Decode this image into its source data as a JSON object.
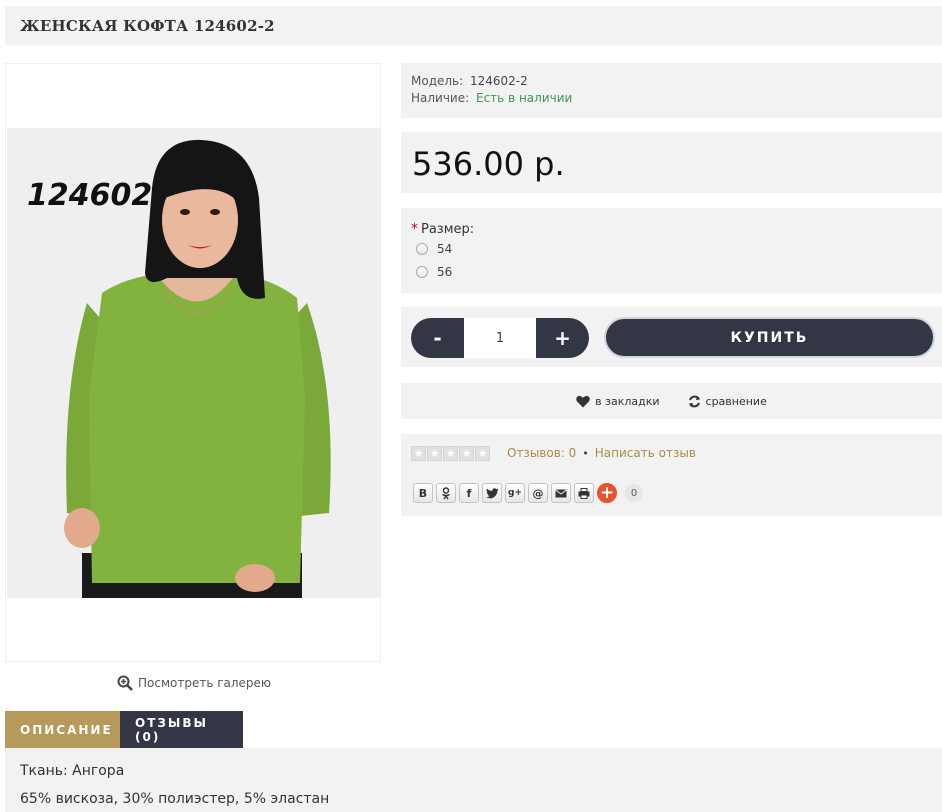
{
  "product": {
    "title": "ЖЕНСКАЯ КОФТА 124602-2",
    "image_code": "124602",
    "gallery_link": "Посмотреть галерею"
  },
  "info": {
    "model_label": "Модель:",
    "model_value": "124602-2",
    "availability_label": "Наличие:",
    "availability_value": "Есть в наличии",
    "availability_color": "#3c9a4a"
  },
  "price": "536.00 р.",
  "options": {
    "label": "Размер:",
    "required_mark": "*",
    "sizes": [
      "54",
      "56"
    ]
  },
  "purchase": {
    "minus": "-",
    "quantity": "1",
    "plus": "+",
    "buy_label": "КУПИТЬ"
  },
  "actions": {
    "bookmark_label": "в закладки",
    "compare_label": "сравнение"
  },
  "rating": {
    "stars": 0,
    "max_stars": 5,
    "reviews_label": "Отзывов: 0",
    "separator": "•",
    "write_review": "Написать отзыв"
  },
  "share": {
    "buttons": [
      "vk-icon",
      "odnoklassniki-icon",
      "facebook-icon",
      "twitter-icon",
      "google-plus-icon",
      "mailru-icon",
      "email-icon",
      "print-icon",
      "more-share-icon"
    ],
    "glyphs": [
      "В",
      "ok",
      "f",
      "tw",
      "g+",
      "@",
      "✉",
      "⎙",
      "+"
    ],
    "count": "0"
  },
  "tabs": [
    {
      "label": "ОПИСАНИЕ",
      "active": true
    },
    {
      "label": "ОТЗЫВЫ (0)",
      "active": false
    }
  ],
  "description": {
    "line1": "Ткань: Ангора",
    "line2": "65% вискоза, 30% полиэстер, 5% эластан"
  },
  "colors": {
    "accent_gold": "#b59a5a",
    "dark_button": "#333745",
    "panel_bg": "#f2f2f2",
    "link_gold": "#a88d45"
  }
}
